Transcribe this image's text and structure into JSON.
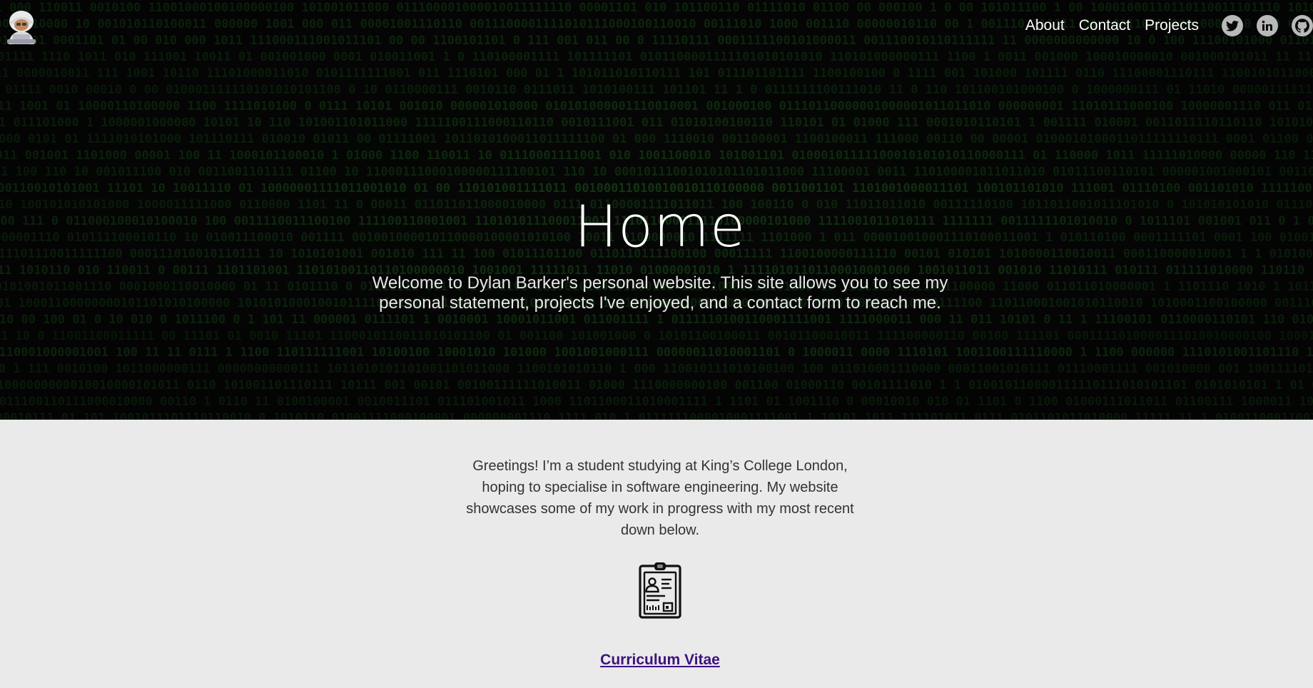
{
  "nav": {
    "links": [
      "About",
      "Contact",
      "Projects"
    ],
    "social_icons": [
      "twitter-icon",
      "linkedin-icon",
      "github-icon"
    ],
    "logo_icon": "hacker-avatar-icon"
  },
  "hero": {
    "title": "Home",
    "subtitle": "Welcome to Dylan Barker's personal website. This site allows you to see my personal statement, projects I've enjoyed, and a contact form to reach me.",
    "background": "binary-matrix-pattern"
  },
  "main": {
    "intro": "Greetings! I’m a student studying at King’s College London, hoping to specialise in software engineering. My website showcases some of my work in progress with my most recent down below.",
    "cv_icon": "id-badge-icon",
    "cv_link": "Curriculum Vitae"
  },
  "colors": {
    "hero_bg": "#070907",
    "matrix_green": "#1f5a1f",
    "content_bg": "#eaeaea",
    "link_purple": "#3d1280",
    "social_grey": "#b9b9b9"
  }
}
